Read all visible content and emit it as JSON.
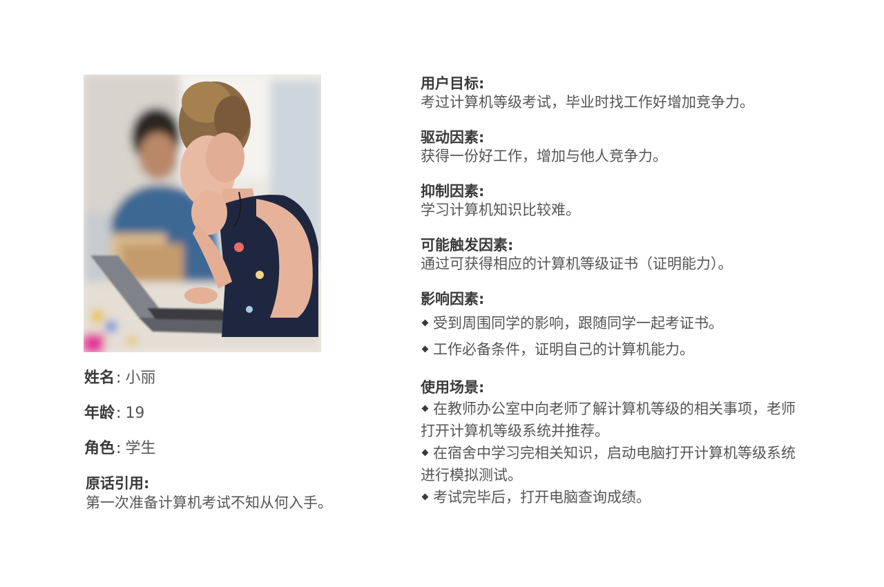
{
  "profile": {
    "name_label": "姓名",
    "name_value": "小丽",
    "age_label": "年龄",
    "age_value": "19",
    "role_label": "角色",
    "role_value": "学生",
    "quote_label": "原话引用",
    "quote_text": "第一次准备计算机考试不知从何入手。",
    "separator": ":"
  },
  "sections": {
    "goal": {
      "title": "用户目标",
      "text": "考过计算机等级考试，毕业时找工作好增加竞争力。"
    },
    "drivers": {
      "title": "驱动因素",
      "text": "获得一份好工作，增加与他人竞争力。"
    },
    "inhibitors": {
      "title": "抑制因素",
      "text": "学习计算机知识比较难。"
    },
    "triggers": {
      "title": "可能触发因素",
      "text": "通过可获得相应的计算机等级证书（证明能力）。"
    },
    "influences": {
      "title": "影响因素",
      "items": [
        "受到周围同学的影响，跟随同学一起考证书。",
        "工作必备条件，证明自己的计算机能力。"
      ]
    },
    "scenarios": {
      "title": "使用场景",
      "items": [
        "在教师办公室中向老师了解计算机等级的相关事项，老师打开计算机等级系统并推荐。",
        "在宿舍中学习完相关知识，启动电脑打开计算机等级系统进行模拟测试。",
        "考试完毕后，打开电脑查询成绩。"
      ]
    }
  },
  "colors": {
    "heading": "#3a3a3a",
    "body_text": "#555555",
    "background": "#ffffff"
  },
  "photo": {
    "icon": "persona-photo"
  }
}
